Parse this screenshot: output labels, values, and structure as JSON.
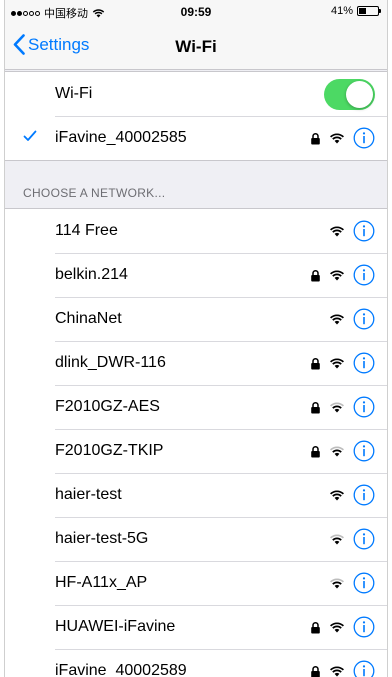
{
  "status_bar": {
    "carrier": "中国移动",
    "time": "09:59",
    "battery": "41%",
    "battery_level": 0.41
  },
  "nav": {
    "back_label": "Settings",
    "title": "Wi-Fi"
  },
  "wifi_toggle": {
    "label": "Wi-Fi",
    "on": true
  },
  "connected": {
    "name": "iFavine_40002585",
    "secured": true
  },
  "section_header": "CHOOSE A NETWORK...",
  "networks": [
    {
      "name": "114 Free",
      "secured": false,
      "signal": "full"
    },
    {
      "name": "belkin.214",
      "secured": true,
      "signal": "full"
    },
    {
      "name": "ChinaNet",
      "secured": false,
      "signal": "full"
    },
    {
      "name": "dlink_DWR-116",
      "secured": true,
      "signal": "full"
    },
    {
      "name": "F2010GZ-AES",
      "secured": true,
      "signal": "medium"
    },
    {
      "name": "F2010GZ-TKIP",
      "secured": true,
      "signal": "medium"
    },
    {
      "name": "haier-test",
      "secured": false,
      "signal": "full"
    },
    {
      "name": "haier-test-5G",
      "secured": false,
      "signal": "medium"
    },
    {
      "name": "HF-A11x_AP",
      "secured": false,
      "signal": "medium"
    },
    {
      "name": "HUAWEI-iFavine",
      "secured": true,
      "signal": "full"
    },
    {
      "name": "iFavine_40002589",
      "secured": true,
      "signal": "full"
    }
  ],
  "colors": {
    "accent": "#007aff",
    "toggle_on": "#4cd964"
  },
  "icons": {
    "lock": "lock-icon",
    "wifi": "wifi-icon",
    "info": "info-icon",
    "check": "checkmark-icon",
    "back": "chevron-left-icon"
  }
}
